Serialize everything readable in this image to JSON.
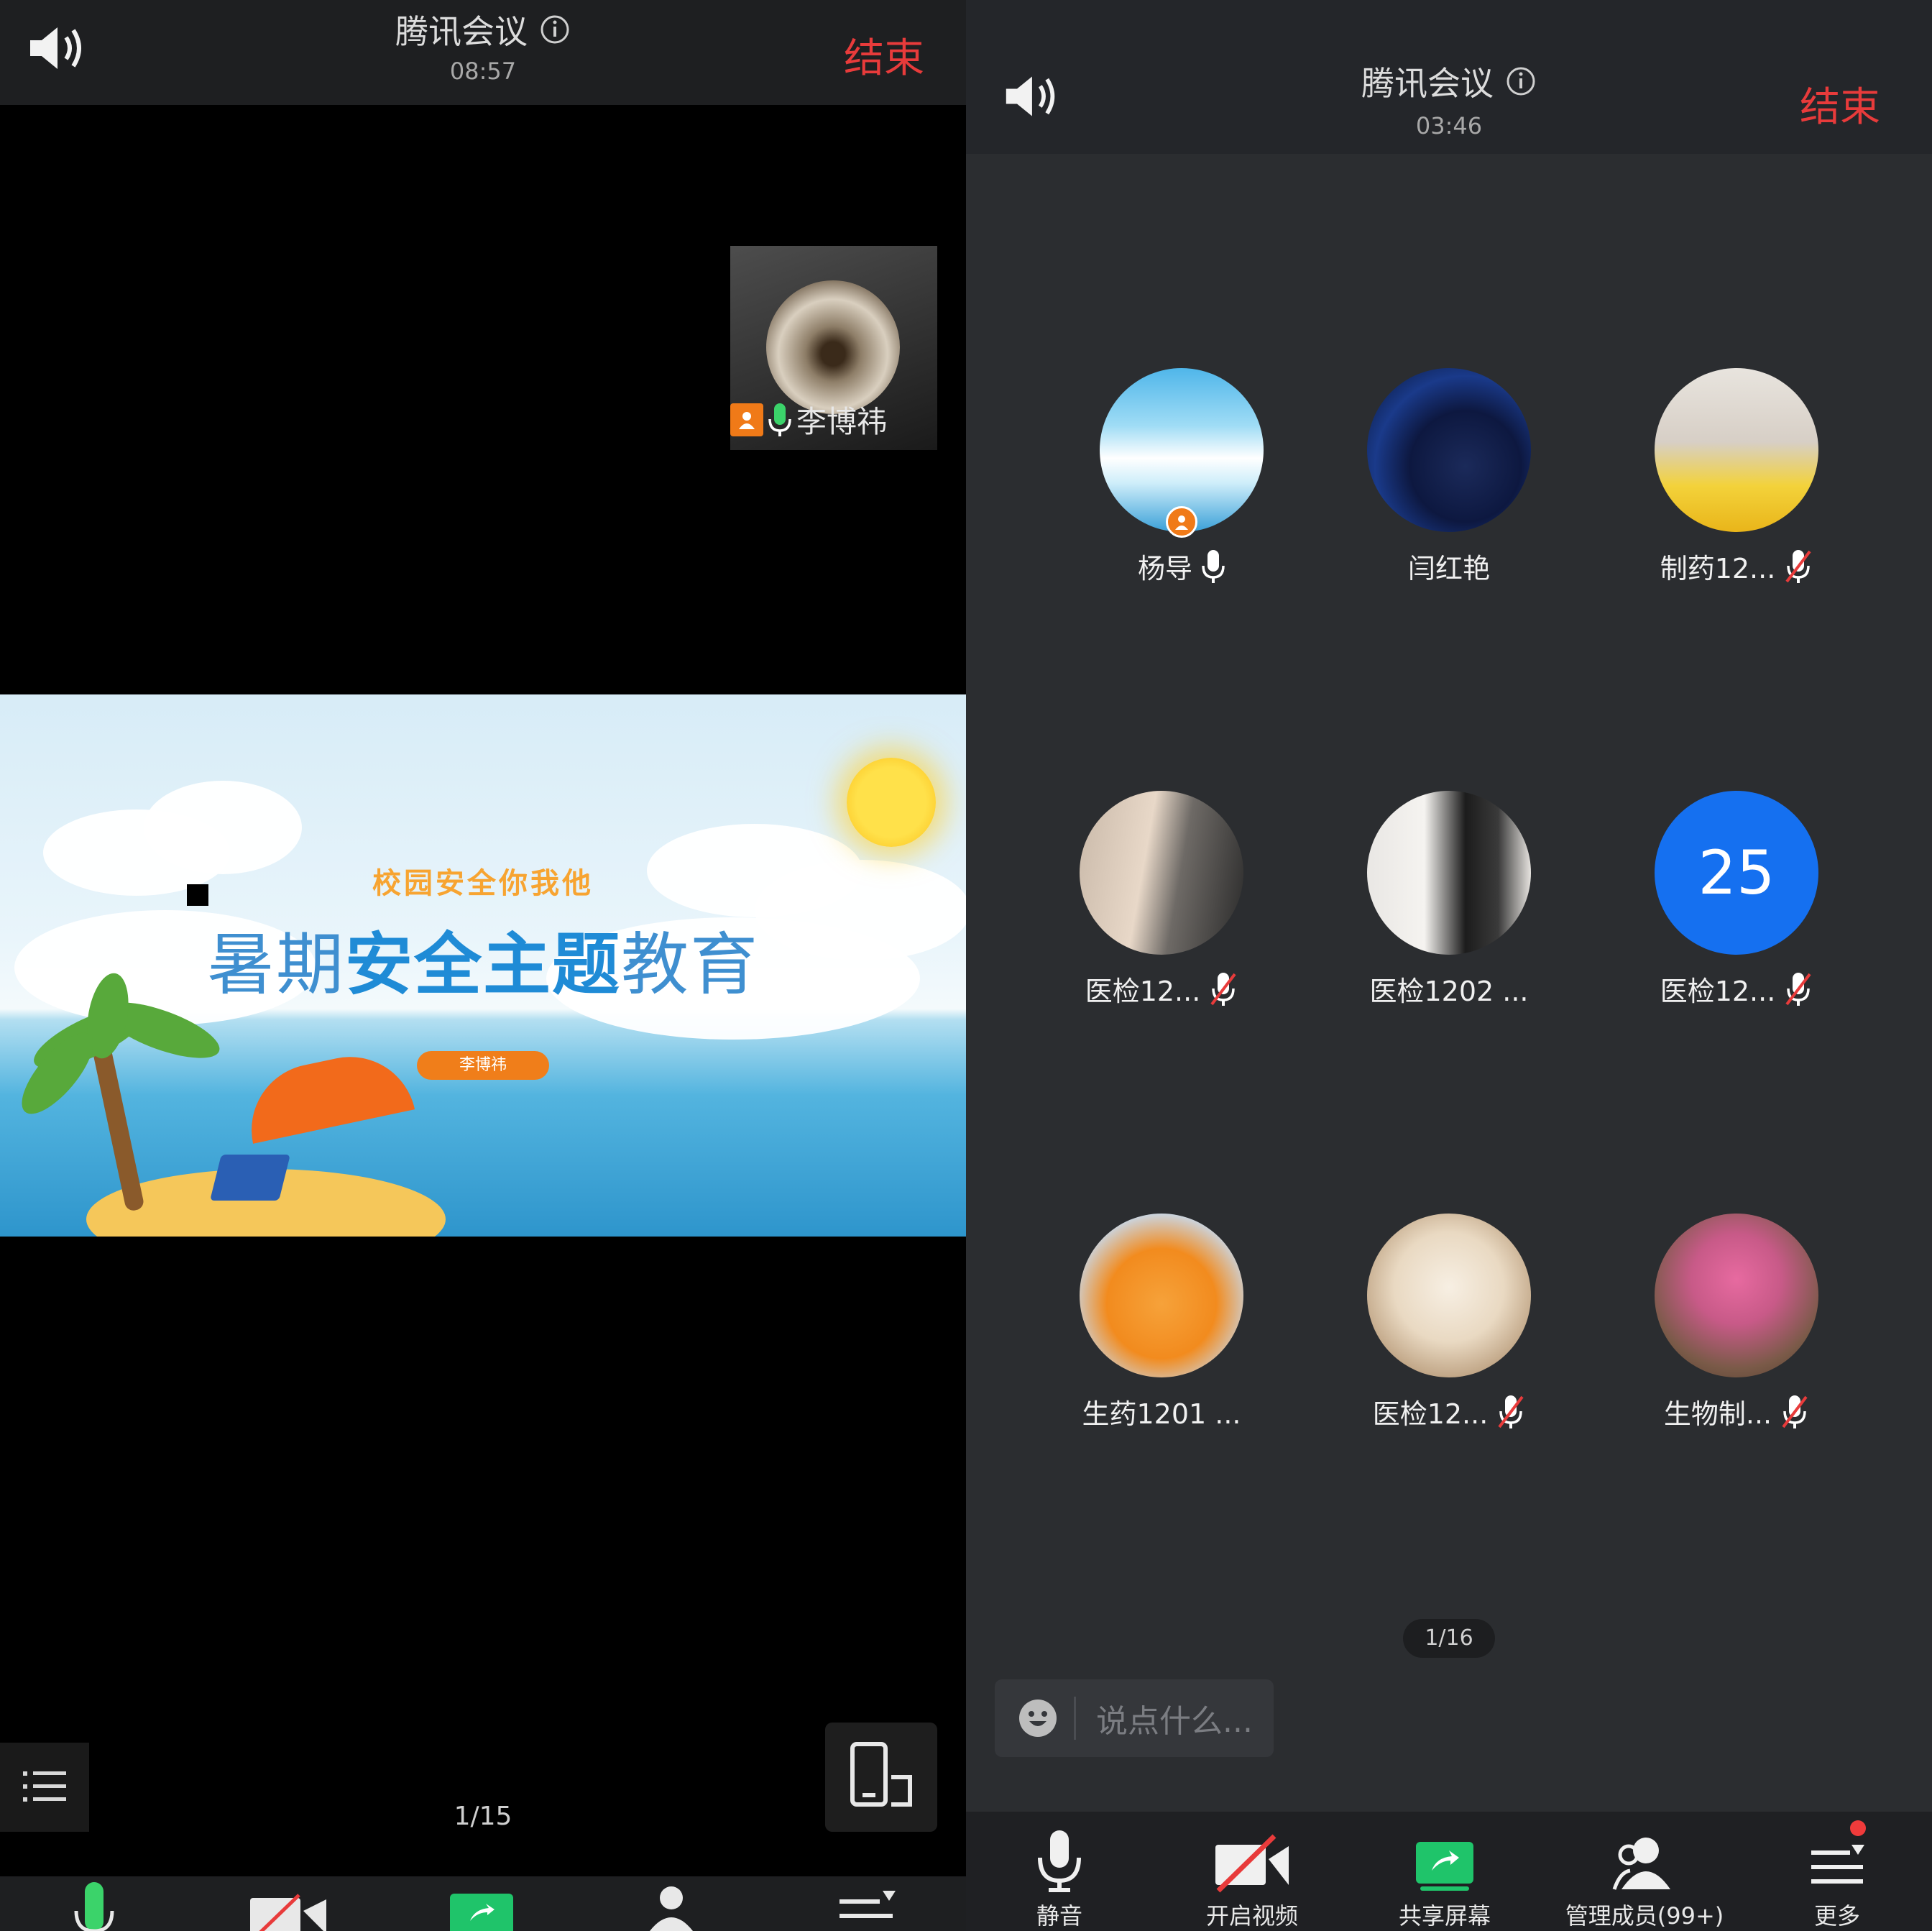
{
  "left": {
    "title": "腾讯会议",
    "time": "08:57",
    "end_label": "结束",
    "pip": {
      "name": "李博祎"
    },
    "slide": {
      "subtitle": "校园安全你我他",
      "title_part1": "暑期",
      "title_part2": "安全主题",
      "title_part3": "教育",
      "presenter": "李博祎"
    },
    "page_indicator": "1/15"
  },
  "right": {
    "title": "腾讯会议",
    "time": "03:46",
    "end_label": "结束",
    "participants": [
      {
        "name": "杨导",
        "mic": "on",
        "host": true,
        "avatar": "sky"
      },
      {
        "name": "闫红艳",
        "mic": "none",
        "avatar": "night"
      },
      {
        "name": "制药12...",
        "mic": "muted",
        "avatar": "duck"
      },
      {
        "name": "医检12...",
        "mic": "muted",
        "avatar": "girl"
      },
      {
        "name": "医检1202 ...",
        "mic": "none",
        "avatar": "pair"
      },
      {
        "name": "医检12...",
        "mic": "muted",
        "avatar": "number",
        "avatar_text": "25"
      },
      {
        "name": "生药1201 ...",
        "mic": "none",
        "avatar": "tiger"
      },
      {
        "name": "医检12...",
        "mic": "muted",
        "avatar": "cat"
      },
      {
        "name": "生物制...",
        "mic": "muted",
        "avatar": "bear"
      }
    ],
    "page_indicator": "1/16",
    "chat_placeholder": "说点什么...",
    "toolbar": {
      "mute": "静音",
      "video": "开启视频",
      "share": "共享屏幕",
      "members": "管理成员(99+)",
      "more": "更多"
    }
  },
  "colors": {
    "end_red": "#e83b3b",
    "share_green": "#1fc46a",
    "avatar_blue": "#1570f0",
    "host_orange": "#f07a18"
  }
}
